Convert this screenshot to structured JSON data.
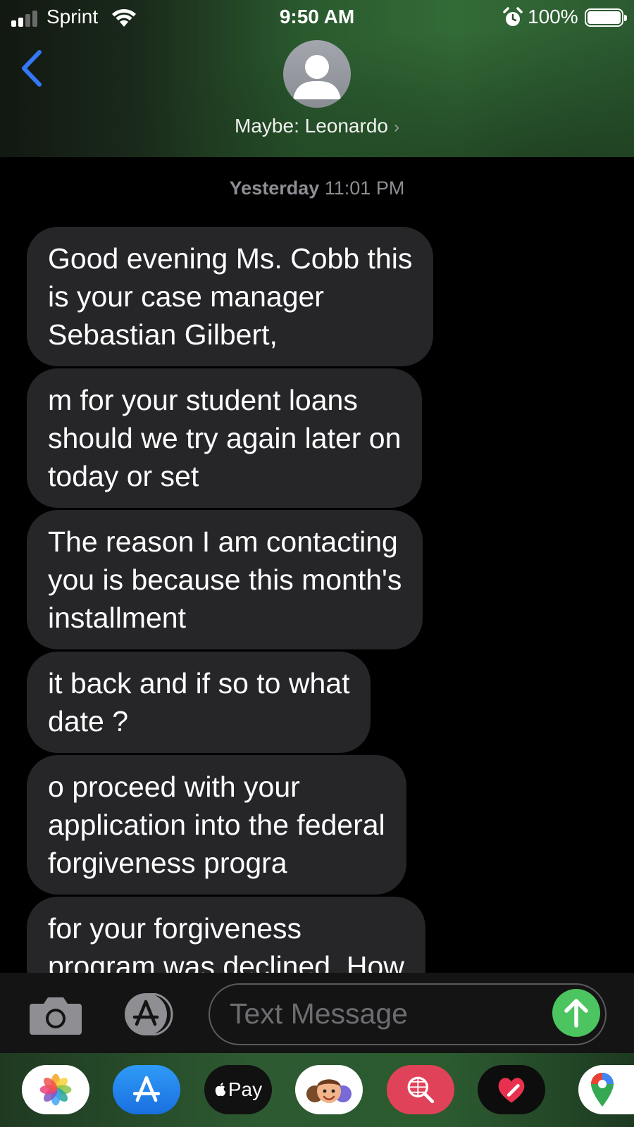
{
  "status_bar": {
    "carrier": "Sprint",
    "time": "9:50 AM",
    "battery": "100%",
    "battery_level": 1.0,
    "signal_bars": 2
  },
  "header": {
    "back_icon": "chevron-left-icon",
    "avatar_icon": "person-silhouette-icon",
    "contact_name": "Maybe: Leonardo",
    "chevron": "›"
  },
  "thread": {
    "timestamp_day": "Yesterday",
    "timestamp_time": "11:01 PM",
    "messages": [
      {
        "text": "Good evening Ms. Cobb this\nis your case manager\nSebastian Gilbert,"
      },
      {
        "text": "m for your student loans\nshould we try again later on\ntoday or set"
      },
      {
        "text": "The reason I am contacting\nyou is because this month's\ninstallment"
      },
      {
        "text": "it back and if so to what\ndate  ?"
      },
      {
        "text": "o proceed with your\napplication into the federal\nforgiveness progra"
      },
      {
        "text": "for your forgiveness\nprogram was declined. How"
      }
    ]
  },
  "input_bar": {
    "camera_icon": "camera-icon",
    "apps_icon": "app-store-icon",
    "placeholder": "Text Message",
    "value": "",
    "send_icon": "arrow-up-icon"
  },
  "app_tray": {
    "apps": [
      {
        "name": "photos",
        "icon": "photos-icon"
      },
      {
        "name": "app-store",
        "icon": "app-store-icon"
      },
      {
        "name": "apple-pay",
        "icon": "apple-pay-icon",
        "label": "Pay"
      },
      {
        "name": "memoji",
        "icon": "memoji-icon"
      },
      {
        "name": "web-search",
        "icon": "globe-search-icon"
      },
      {
        "name": "digital-touch",
        "icon": "heart-icon"
      },
      {
        "name": "maps",
        "icon": "map-pin-icon"
      }
    ]
  },
  "colors": {
    "bubble": "#262629",
    "send": "#4cc45f",
    "back": "#3478f6",
    "header_green": "#336b37"
  }
}
